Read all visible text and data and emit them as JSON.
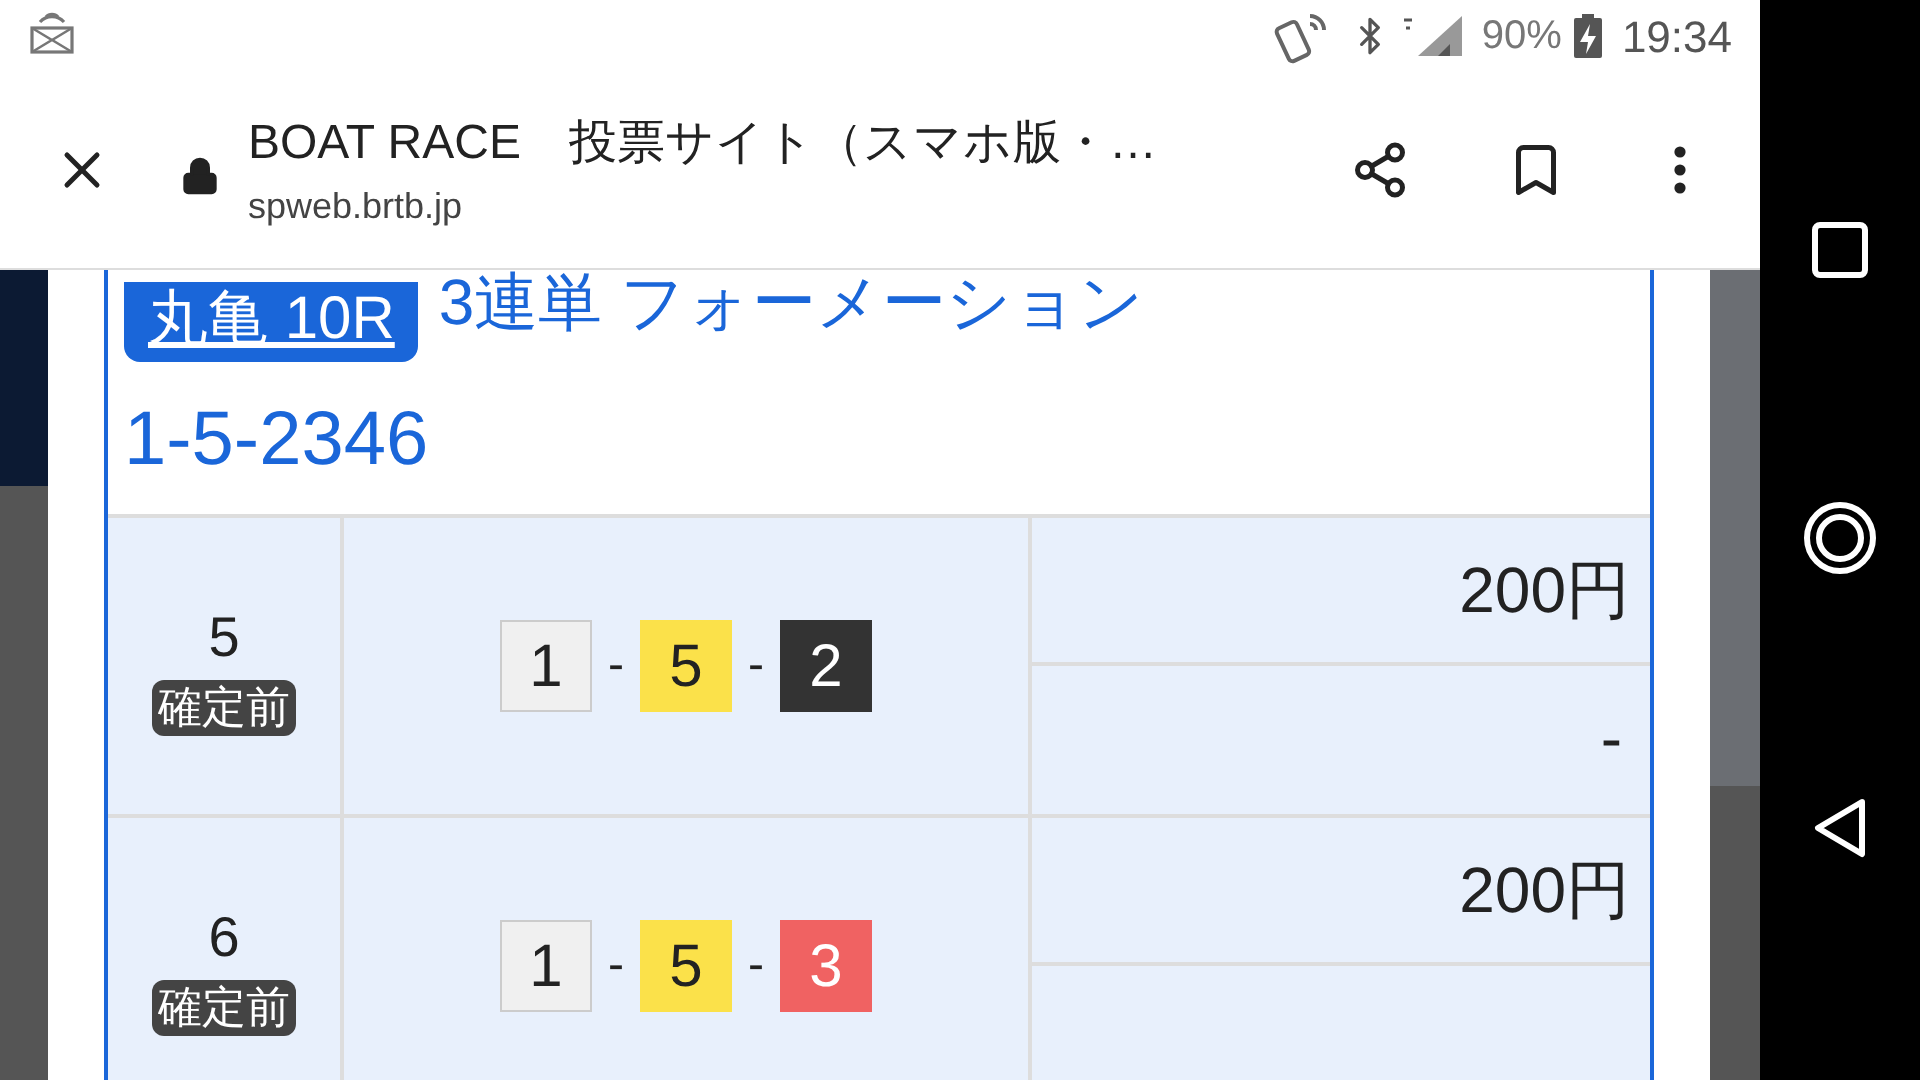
{
  "status_bar": {
    "battery": "90%",
    "time": "19:34"
  },
  "browser": {
    "title": "BOAT RACE　投票サイト（スマホ版・…",
    "url": "spweb.brtb.jp"
  },
  "bet": {
    "race": "丸亀 10R",
    "type": "3連単 フォーメーション",
    "combination": "1-5-2346"
  },
  "rows": [
    {
      "number": "5",
      "status": "確定前",
      "boats": [
        {
          "label": "1",
          "color": "#f0f0f0"
        },
        {
          "label": "5",
          "color": "#fbe14a"
        },
        {
          "label": "2",
          "color": "#333333"
        }
      ],
      "separators": [
        "-",
        "-"
      ],
      "amount": "200円",
      "payout": "-"
    },
    {
      "number": "6",
      "status": "確定前",
      "boats": [
        {
          "label": "1",
          "color": "#f0f0f0"
        },
        {
          "label": "5",
          "color": "#fbe14a"
        },
        {
          "label": "3",
          "color": "#f06262"
        }
      ],
      "separators": [
        "-",
        "-"
      ],
      "amount": "200円"
    }
  ]
}
